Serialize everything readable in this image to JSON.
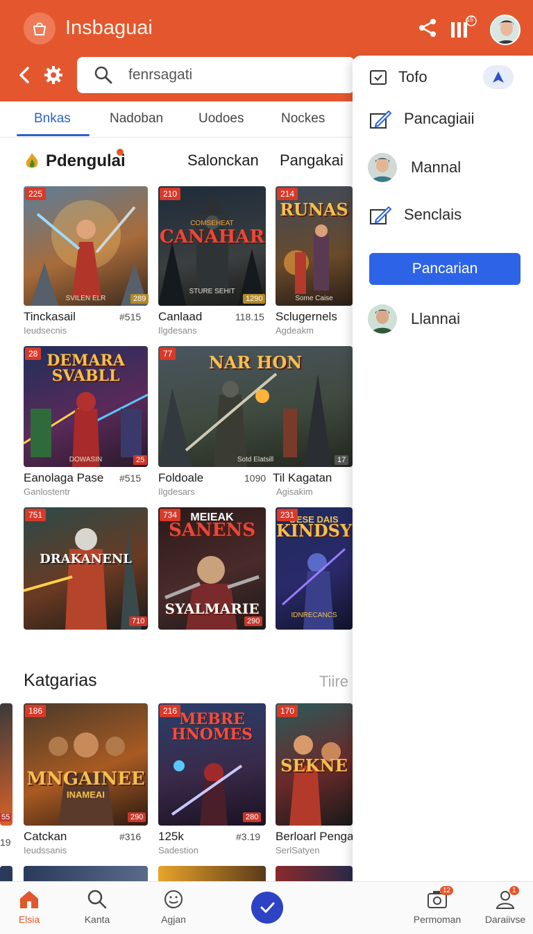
{
  "header": {
    "title": "Insbaguai",
    "notification_count": "15"
  },
  "search": {
    "value": "fenrsagati"
  },
  "tabs": [
    {
      "label": "Bnkas",
      "active": true
    },
    {
      "label": "Nadoban"
    },
    {
      "label": "Uodoes"
    },
    {
      "label": "Nockes"
    }
  ],
  "section1": {
    "title": "Pdengulai",
    "links": [
      "Salonckan",
      "Pangakai"
    ]
  },
  "grid1": [
    {
      "title": "Tinckasail",
      "num": "#515",
      "sub": "Ieudsecnis",
      "badge": "225",
      "rbadge": "289",
      "cover": "SVILEN ELR"
    },
    {
      "title": "Canlaad",
      "num": "118.15",
      "sub": "Ilgdesans",
      "badge": "210",
      "rbadge": "1290",
      "cover": "CANAHAR",
      "cover_top": "COMSEHEAT",
      "cover_bottom": "STURE SEHIT"
    },
    {
      "title": "Sclugernels",
      "num": "",
      "sub": "Agdeakm",
      "badge": "214",
      "rbadge": "",
      "cover": "RUNAS",
      "cover_bottom": "Some Caise"
    },
    {
      "title": "Eanolaga Pase",
      "num": "#515",
      "sub": "Ganlostentr",
      "badge": "28",
      "rbadge": "25",
      "cover": "DEMARA SVABLL",
      "cover_bottom": "DOWASIN"
    },
    {
      "title": "Foldoale",
      "num": "1090",
      "sub": "Ilgdesars",
      "badge": "77",
      "rbadge": "17",
      "cover": "NAR HON",
      "cover_bottom": "Sotd Elatsill"
    },
    {
      "title": "Til Kagatan",
      "num": "",
      "sub": "Agisakim",
      "badge": "",
      "rbadge": "",
      "cover": ""
    },
    {
      "title": "",
      "num": "",
      "sub": "",
      "badge": "751",
      "rbadge": "",
      "cover": "DRAKANENL"
    },
    {
      "title": "",
      "num": "",
      "sub": "",
      "badge": "734",
      "rbadge": "290",
      "cover": "SANENS",
      "cover_top": "MEIEAK",
      "cover_bottom": "SYALMARIE"
    },
    {
      "title": "",
      "num": "",
      "sub": "",
      "badge": "231",
      "rbadge": "",
      "cover": "KINDSY",
      "cover_top": "DESE DAIS",
      "cover_bottom": "IDNRECANCS"
    }
  ],
  "section2": {
    "title": "Katgarias",
    "more": "Tiire"
  },
  "grid2": [
    {
      "title": "Catckan",
      "num": "#316",
      "sub": "Ieudssanis",
      "badge": "186",
      "rbadge": "290",
      "cover": "MNGAINEE",
      "cover_bottom": "INAMEAI"
    },
    {
      "title": "125k",
      "num": "#3.19",
      "sub": "Sadestion",
      "badge": "216",
      "rbadge": "280",
      "cover": "MEBRE HNOMES"
    },
    {
      "title": "Berloarl Pengan",
      "num": "",
      "sub": "SerlSatyen",
      "badge": "170",
      "rbadge": "",
      "cover": "SEKNE"
    }
  ],
  "edge_left": {
    "num": "19",
    "badge": "55"
  },
  "menu": {
    "items": [
      {
        "label": "Tofo",
        "icon": "checkbox-icon"
      },
      {
        "label": "Pancagiaii",
        "icon": "edit-icon"
      },
      {
        "label": "Mannal",
        "icon": "avatar"
      },
      {
        "label": "Senclais",
        "icon": "edit-icon"
      },
      {
        "label": "Llannai",
        "icon": "avatar"
      }
    ],
    "primary_button": "Pancarian"
  },
  "bottom_nav": [
    {
      "label": "Elsia",
      "icon": "home-icon",
      "active": true
    },
    {
      "label": "Kanta",
      "icon": "search-icon"
    },
    {
      "label": "Agjan",
      "icon": "smile-icon"
    },
    {
      "label": "",
      "icon": "check-icon"
    },
    {
      "label": "Permoman",
      "icon": "camera-icon",
      "badge": "12"
    },
    {
      "label": "Daraiivse",
      "icon": "user-icon",
      "badge": "1"
    }
  ],
  "colors": {
    "brand": "#e4572e",
    "accent": "#2d63e6",
    "tab_active": "#2d63c9"
  }
}
